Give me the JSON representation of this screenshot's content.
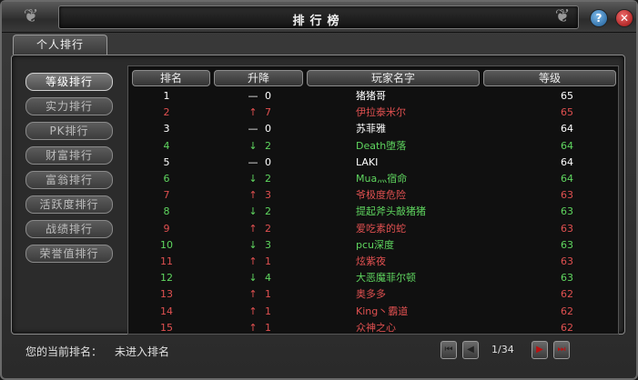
{
  "window": {
    "title": "排行榜"
  },
  "tabs": [
    {
      "label": "个人排行"
    }
  ],
  "sidebar": {
    "items": [
      {
        "label": "等级排行",
        "active": true
      },
      {
        "label": "实力排行",
        "active": false
      },
      {
        "label": "PK排行",
        "active": false
      },
      {
        "label": "财富排行",
        "active": false
      },
      {
        "label": "富翁排行",
        "active": false
      },
      {
        "label": "活跃度排行",
        "active": false
      },
      {
        "label": "战绩排行",
        "active": false
      },
      {
        "label": "荣誉值排行",
        "active": false
      }
    ]
  },
  "table": {
    "headers": {
      "rank": "排名",
      "change": "升降",
      "name": "玩家名字",
      "level": "等级"
    },
    "rows": [
      {
        "rank": "1",
        "arrow": "—",
        "change": "0",
        "name": "猪猪哥",
        "level": "65",
        "color": "#ffffff",
        "arrow_color": "#ffffff"
      },
      {
        "rank": "2",
        "arrow": "↑",
        "change": "7",
        "name": "伊拉泰米尔",
        "level": "65",
        "color": "#e05050",
        "arrow_color": "#e05050"
      },
      {
        "rank": "3",
        "arrow": "—",
        "change": "0",
        "name": "苏菲雅",
        "level": "64",
        "color": "#ffffff",
        "arrow_color": "#ffffff"
      },
      {
        "rank": "4",
        "arrow": "↓",
        "change": "2",
        "name": "Death堕落",
        "level": "64",
        "color": "#5fd65f",
        "arrow_color": "#5fd65f"
      },
      {
        "rank": "5",
        "arrow": "—",
        "change": "0",
        "name": "LAKI",
        "level": "64",
        "color": "#ffffff",
        "arrow_color": "#ffffff"
      },
      {
        "rank": "6",
        "arrow": "↓",
        "change": "2",
        "name": "Mua灬宿命",
        "level": "64",
        "color": "#5fd65f",
        "arrow_color": "#5fd65f"
      },
      {
        "rank": "7",
        "arrow": "↑",
        "change": "3",
        "name": "爷极度危险",
        "level": "63",
        "color": "#e05050",
        "arrow_color": "#e05050"
      },
      {
        "rank": "8",
        "arrow": "↓",
        "change": "2",
        "name": "提起斧头敲猪猪",
        "level": "63",
        "color": "#5fd65f",
        "arrow_color": "#5fd65f"
      },
      {
        "rank": "9",
        "arrow": "↑",
        "change": "2",
        "name": "爱吃素的蛇",
        "level": "63",
        "color": "#e05050",
        "arrow_color": "#e05050"
      },
      {
        "rank": "10",
        "arrow": "↓",
        "change": "3",
        "name": "pcu深度",
        "level": "63",
        "color": "#5fd65f",
        "arrow_color": "#5fd65f"
      },
      {
        "rank": "11",
        "arrow": "↑",
        "change": "1",
        "name": "炫紫夜",
        "level": "63",
        "color": "#e05050",
        "arrow_color": "#e05050"
      },
      {
        "rank": "12",
        "arrow": "↓",
        "change": "4",
        "name": "大恶魔菲尔顿",
        "level": "63",
        "color": "#5fd65f",
        "arrow_color": "#5fd65f"
      },
      {
        "rank": "13",
        "arrow": "↑",
        "change": "1",
        "name": "奥多多",
        "level": "62",
        "color": "#e05050",
        "arrow_color": "#e05050"
      },
      {
        "rank": "14",
        "arrow": "↑",
        "change": "1",
        "name": "King丶霸道",
        "level": "62",
        "color": "#e05050",
        "arrow_color": "#e05050"
      },
      {
        "rank": "15",
        "arrow": "↑",
        "change": "1",
        "name": "众神之心",
        "level": "62",
        "color": "#e05050",
        "arrow_color": "#e05050"
      }
    ]
  },
  "footer": {
    "label": "您的当前排名：",
    "value": "未进入排名"
  },
  "pager": {
    "text": "1/34"
  },
  "controls": {
    "help": "?",
    "close": "✕"
  }
}
